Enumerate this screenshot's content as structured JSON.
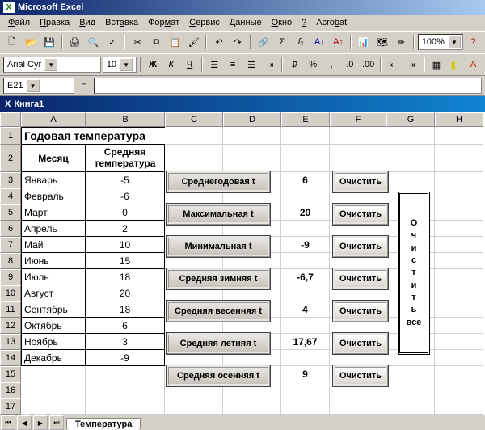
{
  "app_title": "Microsoft Excel",
  "menu": [
    "Файл",
    "Правка",
    "Вид",
    "Вставка",
    "Формат",
    "Сервис",
    "Данные",
    "Окно",
    "?",
    "Acrobat"
  ],
  "toolbar2": {
    "font": "Arial Cyr",
    "size": "10",
    "zoom": "100%",
    "boldK": "Ж",
    "italicK": "К",
    "underlineU": "Ч"
  },
  "namebox": "E21",
  "fx": "=",
  "workbook": "Книга1",
  "columns": [
    "A",
    "B",
    "C",
    "D",
    "E",
    "F",
    "G",
    "H"
  ],
  "table": {
    "title": "Годовая температура",
    "h1": "Месяц",
    "h2": "Средняя температура",
    "rows": [
      {
        "m": "Январь",
        "t": "-5"
      },
      {
        "m": "Февраль",
        "t": "-6"
      },
      {
        "m": "Март",
        "t": "0"
      },
      {
        "m": "Апрель",
        "t": "2"
      },
      {
        "m": "Май",
        "t": "10"
      },
      {
        "m": "Июнь",
        "t": "15"
      },
      {
        "m": "Июль",
        "t": "18"
      },
      {
        "m": "Август",
        "t": "20"
      },
      {
        "m": "Сентябрь",
        "t": "18"
      },
      {
        "m": "Октябрь",
        "t": "6"
      },
      {
        "m": "Ноябрь",
        "t": "3"
      },
      {
        "m": "Декабрь",
        "t": "-9"
      }
    ]
  },
  "compute_buttons": [
    {
      "label": "Среднегодовая t",
      "value": "6"
    },
    {
      "label": "Максимальная  t",
      "value": "20"
    },
    {
      "label": "Минимальная  t",
      "value": "-9"
    },
    {
      "label": "Средняя зимняя t",
      "value": "-6,7"
    },
    {
      "label": "Средняя весенняя t",
      "value": "4"
    },
    {
      "label": "Средняя летняя t",
      "value": "17,67"
    },
    {
      "label": "Средняя осенняя t",
      "value": "9"
    }
  ],
  "clear_label": "Очистить",
  "clear_all_letters": [
    "О",
    "ч",
    "и",
    "с",
    "т",
    "и",
    "т",
    "ь",
    "",
    "все"
  ],
  "sheet_tab": "Температура",
  "chart_data": {
    "type": "table",
    "title": "Годовая температура",
    "columns": [
      "Месяц",
      "Средняя температура"
    ],
    "categories": [
      "Январь",
      "Февраль",
      "Март",
      "Апрель",
      "Май",
      "Июнь",
      "Июль",
      "Август",
      "Сентябрь",
      "Октябрь",
      "Ноябрь",
      "Декабрь"
    ],
    "values": [
      -5,
      -6,
      0,
      2,
      10,
      15,
      18,
      20,
      18,
      6,
      3,
      -9
    ],
    "summary": {
      "Среднегодовая t": 6,
      "Максимальная t": 20,
      "Минимальная t": -9,
      "Средняя зимняя t": -6.7,
      "Средняя весенняя t": 4,
      "Средняя летняя t": 17.67,
      "Средняя осенняя t": 9
    }
  }
}
